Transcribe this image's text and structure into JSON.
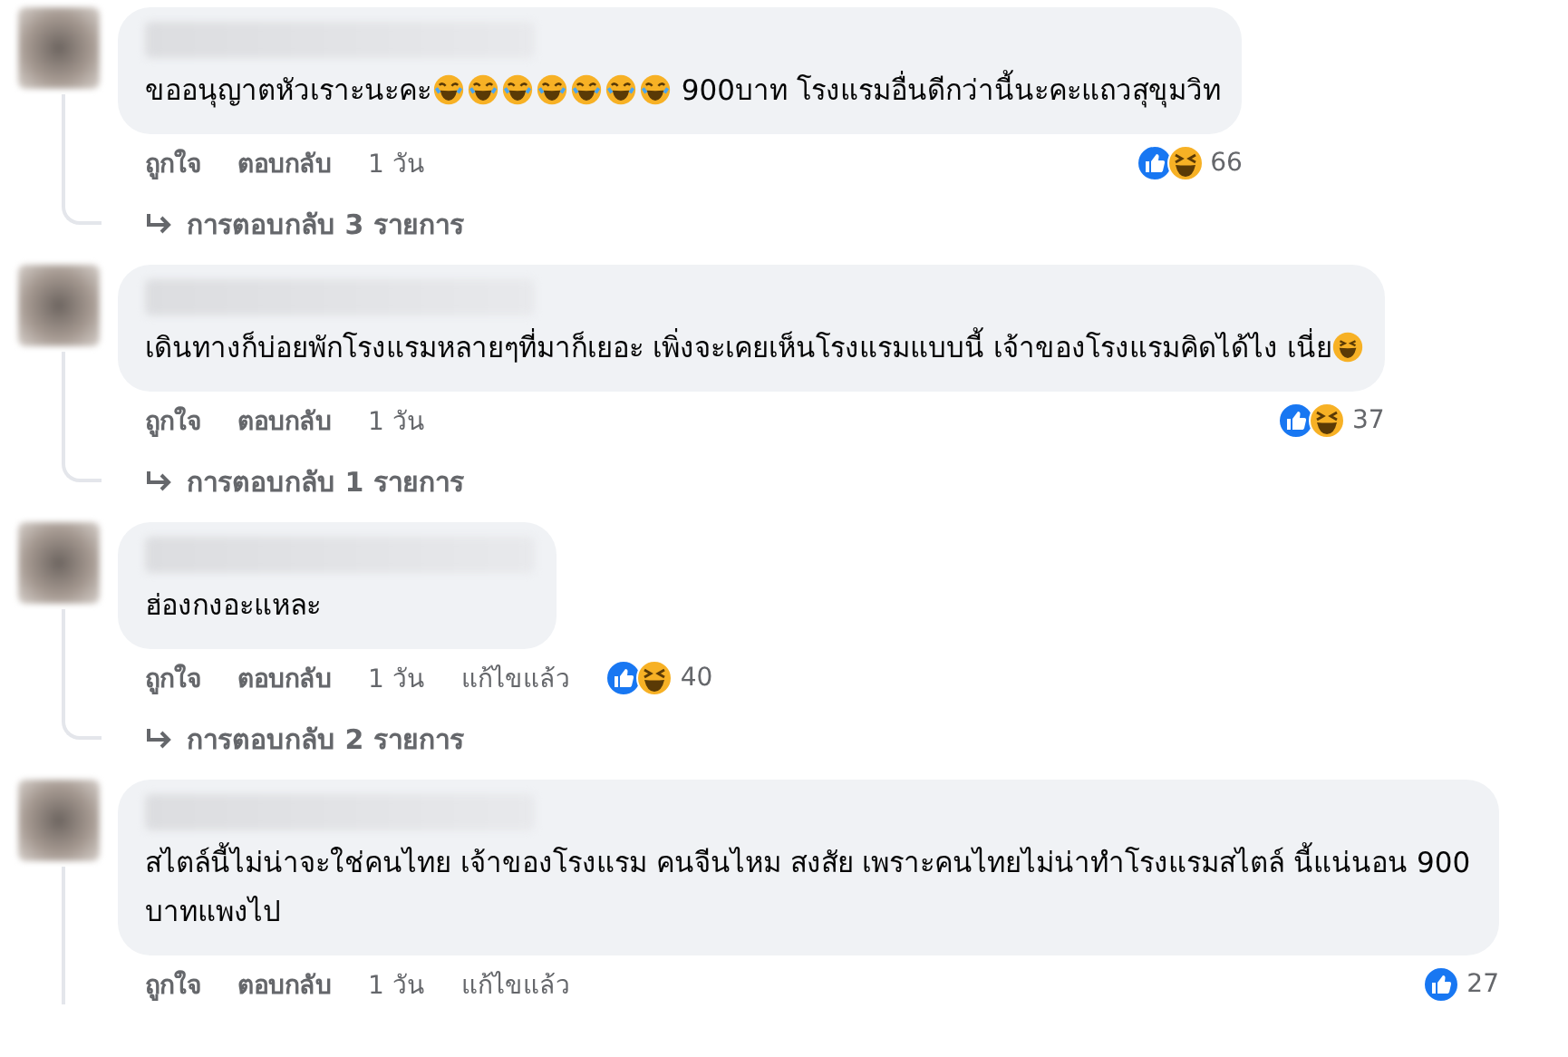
{
  "comments": [
    {
      "segments": [
        {
          "kind": "text",
          "text": "ขออนุญาตหัวเราะนะคะ"
        },
        {
          "kind": "emoji"
        },
        {
          "kind": "emoji"
        },
        {
          "kind": "emoji"
        },
        {
          "kind": "emoji"
        },
        {
          "kind": "emoji"
        },
        {
          "kind": "emoji"
        },
        {
          "kind": "emoji"
        },
        {
          "kind": "text",
          "text": " 900บาท โรงแรมอื่นดีกว่านี้นะคะแถวสุขุมวิท"
        }
      ],
      "actions": [
        {
          "kind": "link",
          "text": "ถูกใจ"
        },
        {
          "kind": "link",
          "text": "ตอบกลับ"
        },
        {
          "kind": "meta",
          "text": "1 วัน"
        }
      ],
      "reactions": [
        {
          "kind": "like"
        },
        {
          "kind": "haha"
        }
      ],
      "reaction_count": "66",
      "replies": "การตอบกลับ 3 รายการ"
    },
    {
      "segments": [
        {
          "kind": "text",
          "text": "เดินทางก็บ่อยพักโรงแรมหลายๆที่มาก็เยอะ เพิ่งจะเคยเห็นโรงแรมแบบนี้ เจ้าของโรงแรมคิดได้ไง เนี่ย"
        },
        {
          "kind": "grin"
        }
      ],
      "actions": [
        {
          "kind": "link",
          "text": "ถูกใจ"
        },
        {
          "kind": "link",
          "text": "ตอบกลับ"
        },
        {
          "kind": "meta",
          "text": "1 วัน"
        }
      ],
      "reactions": [
        {
          "kind": "like"
        },
        {
          "kind": "haha"
        }
      ],
      "reaction_count": "37",
      "replies": "การตอบกลับ 1 รายการ"
    },
    {
      "segments": [
        {
          "kind": "text",
          "text": "ฮ่องกงอะแหละ"
        }
      ],
      "actions": [
        {
          "kind": "link",
          "text": "ถูกใจ"
        },
        {
          "kind": "link",
          "text": "ตอบกลับ"
        },
        {
          "kind": "meta",
          "text": "1 วัน"
        },
        {
          "kind": "meta",
          "text": "แก้ไขแล้ว"
        }
      ],
      "reactions": [
        {
          "kind": "like"
        },
        {
          "kind": "haha"
        }
      ],
      "reaction_count": "40",
      "replies": "การตอบกลับ 2 รายการ"
    },
    {
      "segments": [
        {
          "kind": "text",
          "text": "สไตล์นี้ไม่น่าจะใช่คนไทย เจ้าของโรงแรม คนจีนไหม สงสัย เพราะคนไทยไม่น่าทำโรงแรมสไตล์ นี้แน่นอน 900 บาทแพงไป"
        }
      ],
      "actions": [
        {
          "kind": "link",
          "text": "ถูกใจ"
        },
        {
          "kind": "link",
          "text": "ตอบกลับ"
        },
        {
          "kind": "meta",
          "text": "1 วัน"
        },
        {
          "kind": "meta",
          "text": "แก้ไขแล้ว"
        }
      ],
      "reactions": [
        {
          "kind": "like"
        }
      ],
      "reaction_count": "27"
    }
  ]
}
